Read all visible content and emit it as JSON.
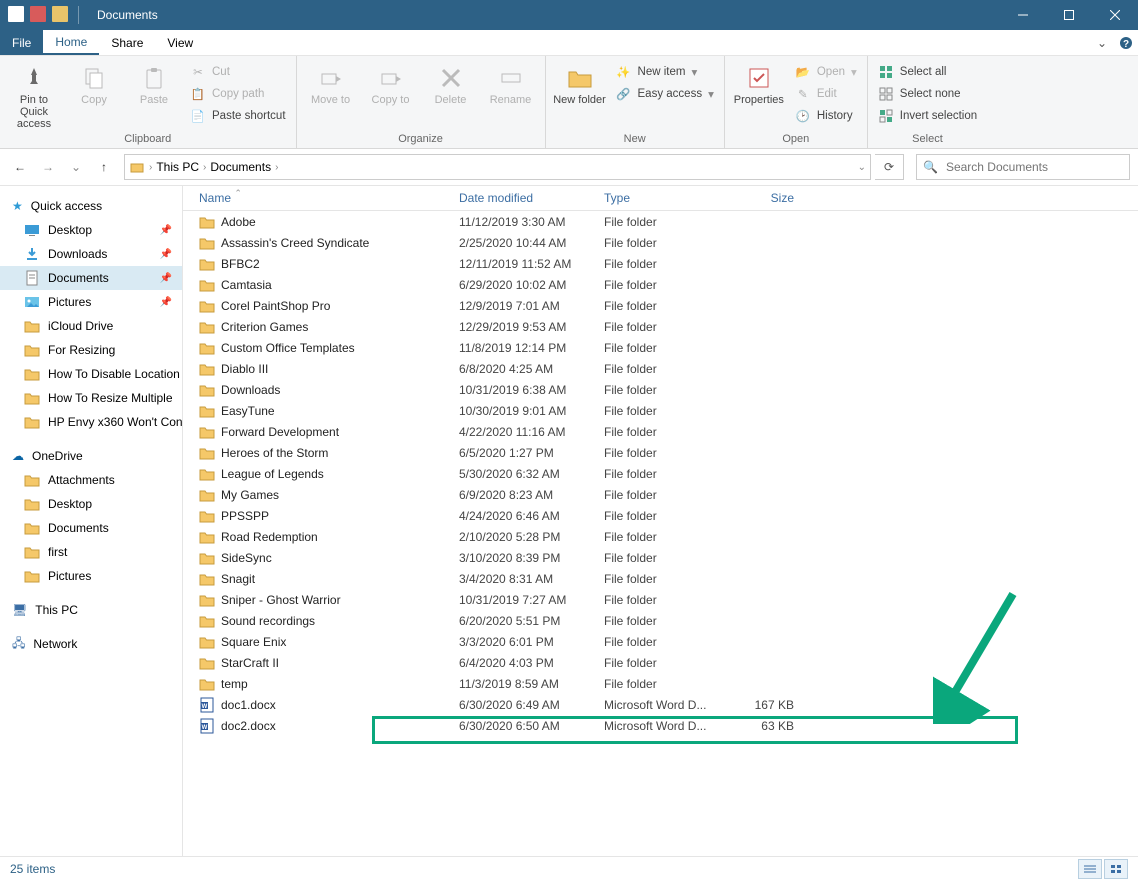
{
  "title": "Documents",
  "menutabs": {
    "file": "File",
    "home": "Home",
    "share": "Share",
    "view": "View"
  },
  "ribbon": {
    "pin": "Pin to Quick access",
    "copy": "Copy",
    "paste": "Paste",
    "cut": "Cut",
    "copypath": "Copy path",
    "pasteshortcut": "Paste shortcut",
    "clipboard": "Clipboard",
    "moveto": "Move to",
    "copyto": "Copy to",
    "delete": "Delete",
    "rename": "Rename",
    "organize": "Organize",
    "newfolder": "New folder",
    "newitem": "New item",
    "easyaccess": "Easy access",
    "new": "New",
    "properties": "Properties",
    "open": "Open",
    "edit": "Edit",
    "history": "History",
    "opengrp": "Open",
    "selectall": "Select all",
    "selectnone": "Select none",
    "invert": "Invert selection",
    "select": "Select"
  },
  "breadcrumbs": [
    "This PC",
    "Documents"
  ],
  "search_placeholder": "Search Documents",
  "sidebar": {
    "quick": "Quick access",
    "items1": [
      {
        "label": "Desktop",
        "icon": "desktop"
      },
      {
        "label": "Downloads",
        "icon": "download"
      },
      {
        "label": "Documents",
        "icon": "doc",
        "sel": true
      },
      {
        "label": "Pictures",
        "icon": "pic"
      },
      {
        "label": "iCloud Drive",
        "icon": "folder"
      },
      {
        "label": "For Resizing",
        "icon": "folder"
      },
      {
        "label": "How To Disable Location",
        "icon": "folder"
      },
      {
        "label": "How To Resize Multiple",
        "icon": "folder"
      },
      {
        "label": "HP Envy x360 Won't Con",
        "icon": "folder"
      }
    ],
    "onedrive": "OneDrive",
    "items2": [
      {
        "label": "Attachments"
      },
      {
        "label": "Desktop"
      },
      {
        "label": "Documents"
      },
      {
        "label": "first"
      },
      {
        "label": "Pictures"
      }
    ],
    "thispc": "This PC",
    "network": "Network"
  },
  "columns": {
    "name": "Name",
    "date": "Date modified",
    "type": "Type",
    "size": "Size"
  },
  "rows": [
    {
      "name": "Adobe",
      "date": "11/12/2019 3:30 AM",
      "type": "File folder",
      "size": "",
      "ic": "folder"
    },
    {
      "name": "Assassin's Creed Syndicate",
      "date": "2/25/2020 10:44 AM",
      "type": "File folder",
      "size": "",
      "ic": "folder"
    },
    {
      "name": "BFBC2",
      "date": "12/11/2019 11:52 AM",
      "type": "File folder",
      "size": "",
      "ic": "folder"
    },
    {
      "name": "Camtasia",
      "date": "6/29/2020 10:02 AM",
      "type": "File folder",
      "size": "",
      "ic": "folder"
    },
    {
      "name": "Corel PaintShop Pro",
      "date": "12/9/2019 7:01 AM",
      "type": "File folder",
      "size": "",
      "ic": "folder"
    },
    {
      "name": "Criterion Games",
      "date": "12/29/2019 9:53 AM",
      "type": "File folder",
      "size": "",
      "ic": "folder"
    },
    {
      "name": "Custom Office Templates",
      "date": "11/8/2019 12:14 PM",
      "type": "File folder",
      "size": "",
      "ic": "folder"
    },
    {
      "name": "Diablo III",
      "date": "6/8/2020 4:25 AM",
      "type": "File folder",
      "size": "",
      "ic": "folder"
    },
    {
      "name": "Downloads",
      "date": "10/31/2019 6:38 AM",
      "type": "File folder",
      "size": "",
      "ic": "folder"
    },
    {
      "name": "EasyTune",
      "date": "10/30/2019 9:01 AM",
      "type": "File folder",
      "size": "",
      "ic": "folder"
    },
    {
      "name": "Forward Development",
      "date": "4/22/2020 11:16 AM",
      "type": "File folder",
      "size": "",
      "ic": "folder"
    },
    {
      "name": "Heroes of the Storm",
      "date": "6/5/2020 1:27 PM",
      "type": "File folder",
      "size": "",
      "ic": "folder"
    },
    {
      "name": "League of Legends",
      "date": "5/30/2020 6:32 AM",
      "type": "File folder",
      "size": "",
      "ic": "folder"
    },
    {
      "name": "My Games",
      "date": "6/9/2020 8:23 AM",
      "type": "File folder",
      "size": "",
      "ic": "folder"
    },
    {
      "name": "PPSSPP",
      "date": "4/24/2020 6:46 AM",
      "type": "File folder",
      "size": "",
      "ic": "folder"
    },
    {
      "name": "Road Redemption",
      "date": "2/10/2020 5:28 PM",
      "type": "File folder",
      "size": "",
      "ic": "folder"
    },
    {
      "name": "SideSync",
      "date": "3/10/2020 8:39 PM",
      "type": "File folder",
      "size": "",
      "ic": "folder"
    },
    {
      "name": "Snagit",
      "date": "3/4/2020 8:31 AM",
      "type": "File folder",
      "size": "",
      "ic": "folder"
    },
    {
      "name": "Sniper - Ghost Warrior",
      "date": "10/31/2019 7:27 AM",
      "type": "File folder",
      "size": "",
      "ic": "folder"
    },
    {
      "name": "Sound recordings",
      "date": "6/20/2020 5:51 PM",
      "type": "File folder",
      "size": "",
      "ic": "folder"
    },
    {
      "name": "Square Enix",
      "date": "3/3/2020 6:01 PM",
      "type": "File folder",
      "size": "",
      "ic": "folder"
    },
    {
      "name": "StarCraft II",
      "date": "6/4/2020 4:03 PM",
      "type": "File folder",
      "size": "",
      "ic": "folder"
    },
    {
      "name": "temp",
      "date": "11/3/2019 8:59 AM",
      "type": "File folder",
      "size": "",
      "ic": "folder"
    },
    {
      "name": "doc1.docx",
      "date": "6/30/2020 6:49 AM",
      "type": "Microsoft Word D...",
      "size": "167 KB",
      "ic": "docx"
    },
    {
      "name": "doc2.docx",
      "date": "6/30/2020 6:50 AM",
      "type": "Microsoft Word D...",
      "size": "63 KB",
      "ic": "docx"
    }
  ],
  "status": "25 items"
}
